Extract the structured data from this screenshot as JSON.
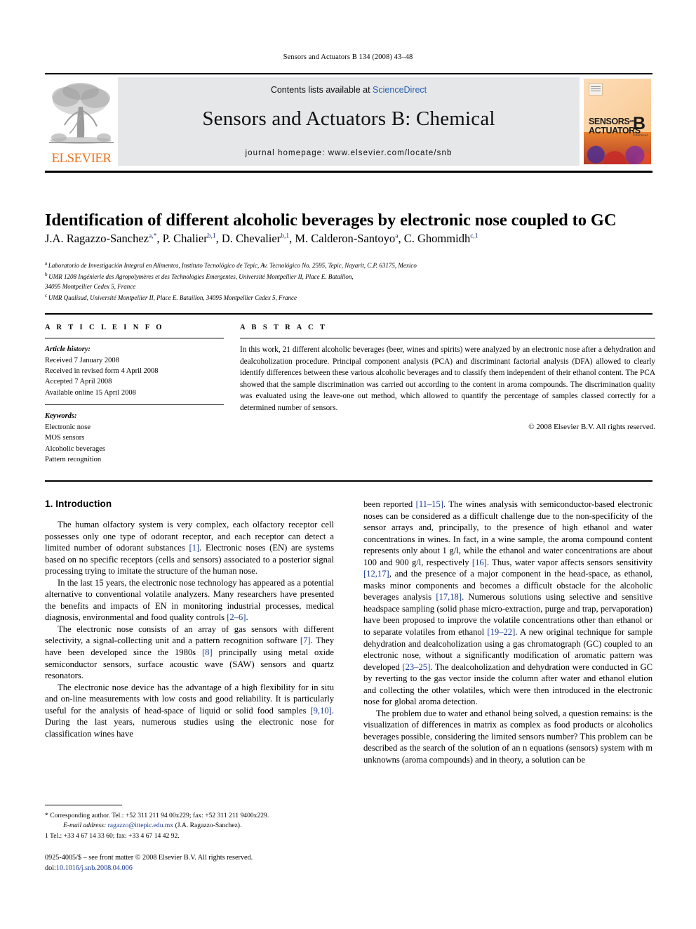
{
  "running_head": "Sensors and Actuators B 134 (2008) 43–48",
  "masthead": {
    "publisher_name": "ELSEVIER",
    "contents_prefix": "Contents lists available at ",
    "contents_link": "ScienceDirect",
    "journal_title": "Sensors and Actuators B: Chemical",
    "homepage_line": "journal homepage: www.elsevier.com/locate/snb",
    "cover": {
      "line1": "SENSORS",
      "line2": "ACTUATORS",
      "small_and": "and",
      "letter": "B",
      "subject": "Chemical"
    },
    "link_color": "#2b60b3",
    "elsevier_orange": "#E87722"
  },
  "article": {
    "title": "Identification of different alcoholic beverages by electronic nose coupled to GC",
    "authors": [
      {
        "name": "J.A. Ragazzo-Sanchez",
        "marks": "a,*"
      },
      {
        "name": "P. Chalier",
        "marks": "b,1"
      },
      {
        "name": "D. Chevalier",
        "marks": "b,1"
      },
      {
        "name": "M. Calderon-Santoyo",
        "marks": "a"
      },
      {
        "name": "C. Ghommidh",
        "marks": "c,1"
      }
    ],
    "affiliations": [
      {
        "mark": "a",
        "text": "Laboratorio de Investigación Integral en Alimentos, Instituto Tecnológico de Tepic, Av. Tecnológico No. 2595, Tepic, Nayarit, C.P. 63175, Mexico"
      },
      {
        "mark": "b",
        "text": "UMR 1208 Ingénierie des Agropolymères et des Technologies Emergentes, Université Montpellier II, Place E. Bataillon,"
      },
      {
        "mark": "",
        "text": "34095 Montpellier Cedex 5, France"
      },
      {
        "mark": "c",
        "text": "UMR Qualisud, Université Montpellier II, Place E. Bataillon, 34095 Montpellier Cedex 5, France"
      }
    ]
  },
  "article_info": {
    "heading": "A R T I C L E    I N F O",
    "history_label": "Article history:",
    "history": [
      "Received 7 January 2008",
      "Received in revised form 4 April 2008",
      "Accepted 7 April 2008",
      "Available online 15 April 2008"
    ],
    "keywords_label": "Keywords:",
    "keywords": [
      "Electronic nose",
      "MOS sensors",
      "Alcoholic beverages",
      "Pattern recognition"
    ]
  },
  "abstract": {
    "heading": "A B S T R A C T",
    "text": "In this work, 21 different alcoholic beverages (beer, wines and spirits) were analyzed by an electronic nose after a dehydration and dealcoholization procedure. Principal component analysis (PCA) and discriminant factorial analysis (DFA) allowed to clearly identify differences between these various alcoholic beverages and to classify them independent of their ethanol content. The PCA showed that the sample discrimination was carried out according to the content in aroma compounds. The discrimination quality was evaluated using the leave-one out method, which allowed to quantify the percentage of samples classed correctly for a determined number of sensors.",
    "copyright": "© 2008 Elsevier B.V. All rights reserved."
  },
  "body": {
    "section_heading": "1.  Introduction",
    "left_paragraphs": [
      "The human olfactory system is very complex, each olfactory receptor cell possesses only one type of odorant receptor, and each receptor can detect a limited number of odorant substances [1]. Electronic noses (EN) are systems based on no specific receptors (cells and sensors) associated to a posterior signal processing trying to imitate the structure of the human nose.",
      "In the last 15 years, the electronic nose technology has appeared as a potential alternative to conventional volatile analyzers. Many researchers have presented the benefits and impacts of EN in monitoring industrial processes, medical diagnosis, environmental and food quality controls [2–6].",
      "The electronic nose consists of an array of gas sensors with different selectivity, a signal-collecting unit and a pattern recognition software [7]. They have been developed since the 1980s [8] principally using metal oxide semiconductor sensors, surface acoustic wave (SAW) sensors and quartz resonators.",
      "The electronic nose device has the advantage of a high flexibility for in situ and on-line measurements with low costs and good reliability. It is particularly useful for the analysis of head-space of liquid or solid food samples [9,10]. During the last years, numerous studies using the electronic nose for classification wines have"
    ],
    "right_paragraphs": [
      "been reported [11–15]. The wines analysis with semiconductor-based electronic noses can be considered as a difficult challenge due to the non-specificity of the sensor arrays and, principally, to the presence of high ethanol and water concentrations in wines. In fact, in a wine sample, the aroma compound content represents only about 1 g/l, while the ethanol and water concentrations are about 100 and 900 g/l, respectively [16]. Thus, water vapor affects sensors sensitivity [12,17], and the presence of a major component in the head-space, as ethanol, masks minor components and becomes a difficult obstacle for the alcoholic beverages analysis [17,18]. Numerous solutions using selective and sensitive headspace sampling (solid phase micro-extraction, purge and trap, pervaporation) have been proposed to improve the volatile concentrations other than ethanol or to separate volatiles from ethanol [19–22]. A new original technique for sample dehydration and dealcoholization using a gas chromatograph (GC) coupled to an electronic nose, without a significantly modification of aromatic pattern was developed [23–25]. The dealcoholization and dehydration were conducted in GC by reverting to the gas vector inside the column after water and ethanol elution and collecting the other volatiles, which were then introduced in the electronic nose for global aroma detection.",
      "The problem due to water and ethanol being solved, a question remains: is the visualization of differences in matrix as complex as food products or alcoholics beverages possible, considering the limited sensors number? This problem can be described as the search of the solution of an n equations (sensors) system with m unknowns (aroma compounds) and in theory, a solution can be"
    ]
  },
  "footnotes": {
    "corresponding": "* Corresponding author. Tel.: +52 311 211 94 00x229; fax: +52 311 211 9400x229.",
    "email_label": "E-mail address:",
    "email": "ragazzo@ittepic.edu.mx",
    "email_owner": "(J.A. Ragazzo-Sanchez).",
    "note1": "1  Tel.: +33 4 67 14 33 60; fax: +33 4 67 14 42 92."
  },
  "imprint": {
    "line1": "0925-4005/$ – see front matter © 2008 Elsevier B.V. All rights reserved.",
    "doi_label": "doi:",
    "doi": "10.1016/j.snb.2008.04.006"
  }
}
